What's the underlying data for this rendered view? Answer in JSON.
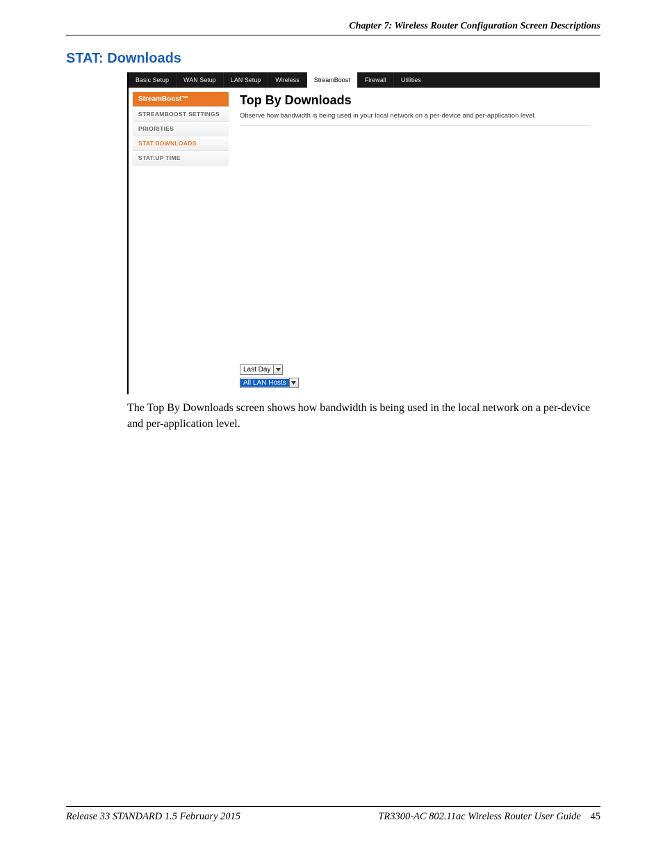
{
  "header": {
    "chapter_line": "Chapter 7: Wireless Router Configuration Screen Descriptions"
  },
  "section": {
    "title": "STAT: Downloads"
  },
  "screenshot": {
    "tabs": {
      "basic": "Basic Setup",
      "wan": "WAN Setup",
      "lan": "LAN Setup",
      "wireless": "Wireless",
      "streamboost": "StreamBoost",
      "firewall": "Firewall",
      "utilities": "Utilities"
    },
    "sidebar": {
      "head": "StreamBoost™",
      "items": {
        "settings": "STREAMBOOST SETTINGS",
        "priorities": "PRIORITIES",
        "downloads": "STAT:DOWNLOADS",
        "uptime": "STAT:UP TIME"
      }
    },
    "content": {
      "title": "Top By Downloads",
      "desc": "Observe how bandwidth is being used in your local network on a per-device and per-application level."
    },
    "selects": {
      "period": "Last Day",
      "hosts": "All LAN Hosts"
    }
  },
  "caption": "The Top By Downloads screen shows how bandwidth is being used in the local network on a per-device and per-application level.",
  "footer": {
    "left": "Release 33 STANDARD 1.5   February 2015",
    "right_doc": "TR3300-AC 802.11ac Wireless Router User Guide",
    "page": "45"
  }
}
